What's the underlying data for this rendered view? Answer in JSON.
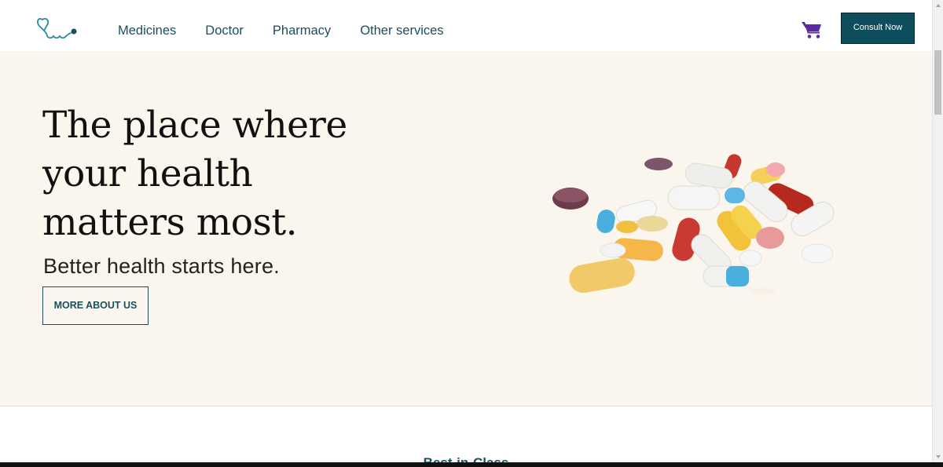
{
  "header": {
    "logo_icon": "stethoscope-icon",
    "nav": [
      {
        "label": "Medicines"
      },
      {
        "label": "Doctor"
      },
      {
        "label": "Pharmacy"
      },
      {
        "label": "Other services"
      }
    ],
    "cart_icon": "shopping-cart-icon",
    "consult_label": "Consult Now"
  },
  "hero": {
    "title": "The place where your health matters most.",
    "subtitle": "Better health starts here.",
    "cta_label": "MORE ABOUT US",
    "image": "pills-image"
  },
  "section": {
    "title": "Best-in-Class"
  },
  "colors": {
    "primary": "#0d4d5c",
    "nav_text": "#1a4f5e",
    "hero_bg": "#faf6ed",
    "cart": "#5b2ca0"
  }
}
